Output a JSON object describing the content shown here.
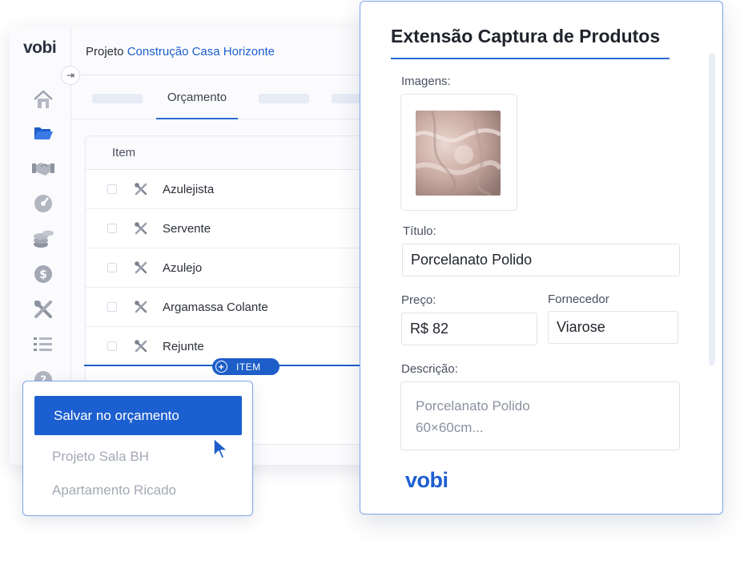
{
  "app": {
    "logo": "vobi",
    "project_prefix": "Projeto",
    "project_name": "Construção Casa Horizonte",
    "active_tab": "Orçamento",
    "table": {
      "header": "Item",
      "rows": [
        "Azulejista",
        "Servente",
        "Azulejo",
        "Argamassa Colante",
        "Rejunte"
      ]
    },
    "add_item_label": "ITEM",
    "sidebar_icons": [
      "home-icon",
      "folder-icon",
      "handshake-icon",
      "gauge-icon",
      "coins-icon",
      "dollar-icon",
      "tools-icon",
      "list-icon",
      "help-icon"
    ]
  },
  "save_menu": {
    "save_label": "Salvar no orçamento",
    "options": [
      "Projeto Sala BH",
      "Apartamento Ricado"
    ]
  },
  "extension": {
    "title": "Extensão Captura de Produtos",
    "images_label": "Imagens:",
    "title_label": "Título:",
    "title_value": "Porcelanato Polido",
    "price_label": "Preço:",
    "price_value": "R$ 82",
    "supplier_label": "Fornecedor",
    "supplier_value": "Viarose",
    "description_label": "Descrição:",
    "description_line1": "Porcelanato Polido",
    "description_line2": "60×60cm...",
    "logo": "vobi"
  },
  "colors": {
    "accent": "#1c5fd0",
    "border_accent": "#7ea4ea"
  }
}
